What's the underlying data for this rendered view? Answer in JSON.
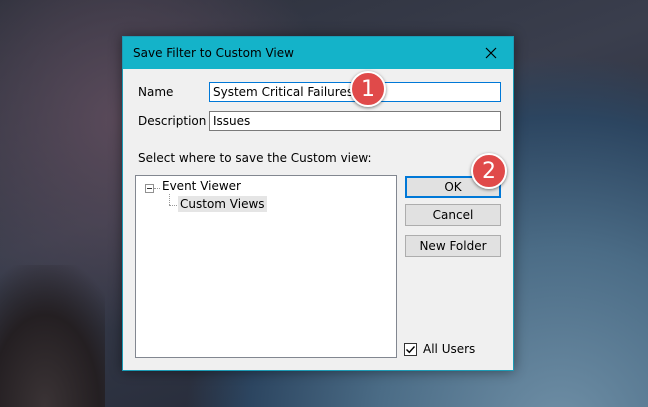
{
  "dialog": {
    "title": "Save Filter to Custom View",
    "name_label": "Name",
    "name_value": "System Critical Failures",
    "description_label": "Description",
    "description_value": "Issues",
    "save_location_label": "Select where to save the Custom view:",
    "tree": {
      "root": "Event Viewer",
      "child": "Custom Views"
    },
    "buttons": {
      "ok": "OK",
      "cancel": "Cancel",
      "new_folder": "New Folder"
    },
    "all_users_label": "All Users",
    "all_users_checked": true
  },
  "annotations": {
    "step1": "1",
    "step2": "2"
  },
  "colors": {
    "title_bar": "#14b3c9",
    "badge": "#e04a4a",
    "focus": "#0078d7"
  }
}
